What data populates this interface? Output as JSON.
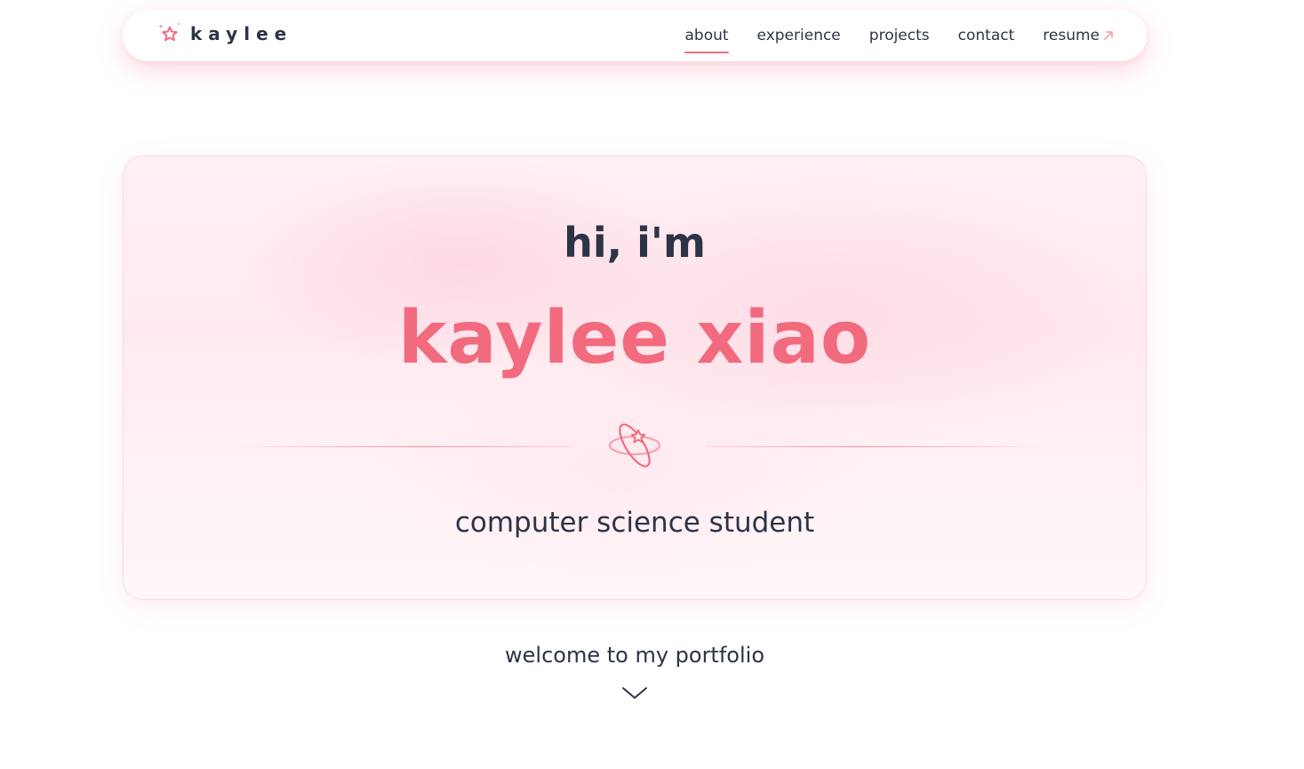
{
  "navbar": {
    "brand": "kaylee",
    "links": [
      {
        "label": "about",
        "active": true
      },
      {
        "label": "experience",
        "active": false
      },
      {
        "label": "projects",
        "active": false
      },
      {
        "label": "contact",
        "active": false
      },
      {
        "label": "resume",
        "active": false,
        "external": true
      }
    ]
  },
  "hero": {
    "greeting": "hi, i'm",
    "name": "kaylee xiao",
    "role": "computer science student"
  },
  "footer": {
    "welcome": "welcome to my portfolio"
  },
  "icons": {
    "brand": "star-sparkle-icon",
    "divider": "star-orbit-icon",
    "resume_link": "arrow-up-right-icon",
    "scroll": "chevron-down-icon"
  },
  "colors": {
    "accent": "#f26a7e",
    "text": "#2d3446",
    "card_bg": "#ffeef3",
    "card_border": "#fbd8df"
  }
}
